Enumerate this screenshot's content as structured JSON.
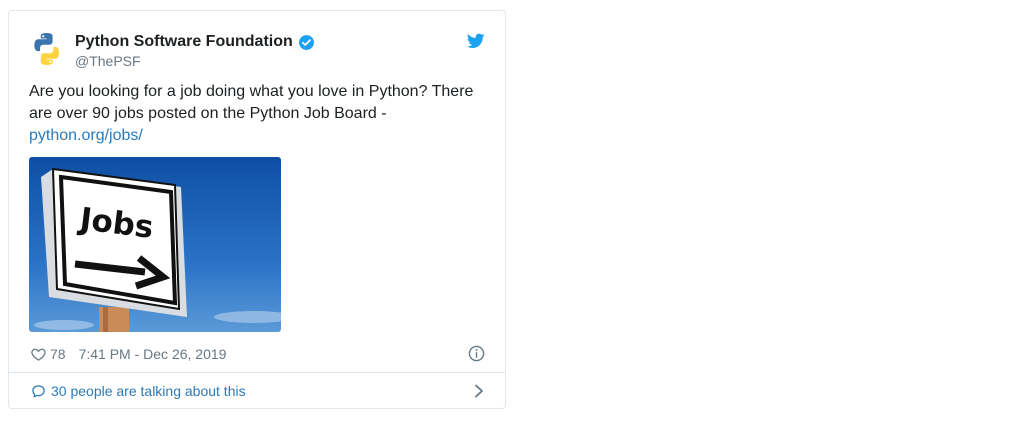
{
  "tweet": {
    "author_name": "Python Software Foundation",
    "author_handle": "@ThePSF",
    "text_line1": "Are you looking for a job doing what you love in Python? There",
    "text_line2": "are over 90 jobs posted on the Python Job Board -",
    "link_text": "python.org/jobs/",
    "image_sign_text": "Jobs",
    "likes": "78",
    "timestamp": "7:41 PM - Dec 26, 2019",
    "talking": "30 people are talking about this"
  },
  "colors": {
    "link": "#2b7bb9",
    "twitter_blue": "#1da1f2",
    "muted": "#697882",
    "border": "#e1e8ed"
  },
  "icons": {
    "avatar": "python-logo-icon",
    "verified": "verified-badge-icon",
    "brand": "twitter-bird-icon",
    "like": "heart-icon",
    "info": "info-icon",
    "reply": "speech-bubble-icon",
    "more": "chevron-right-icon"
  }
}
